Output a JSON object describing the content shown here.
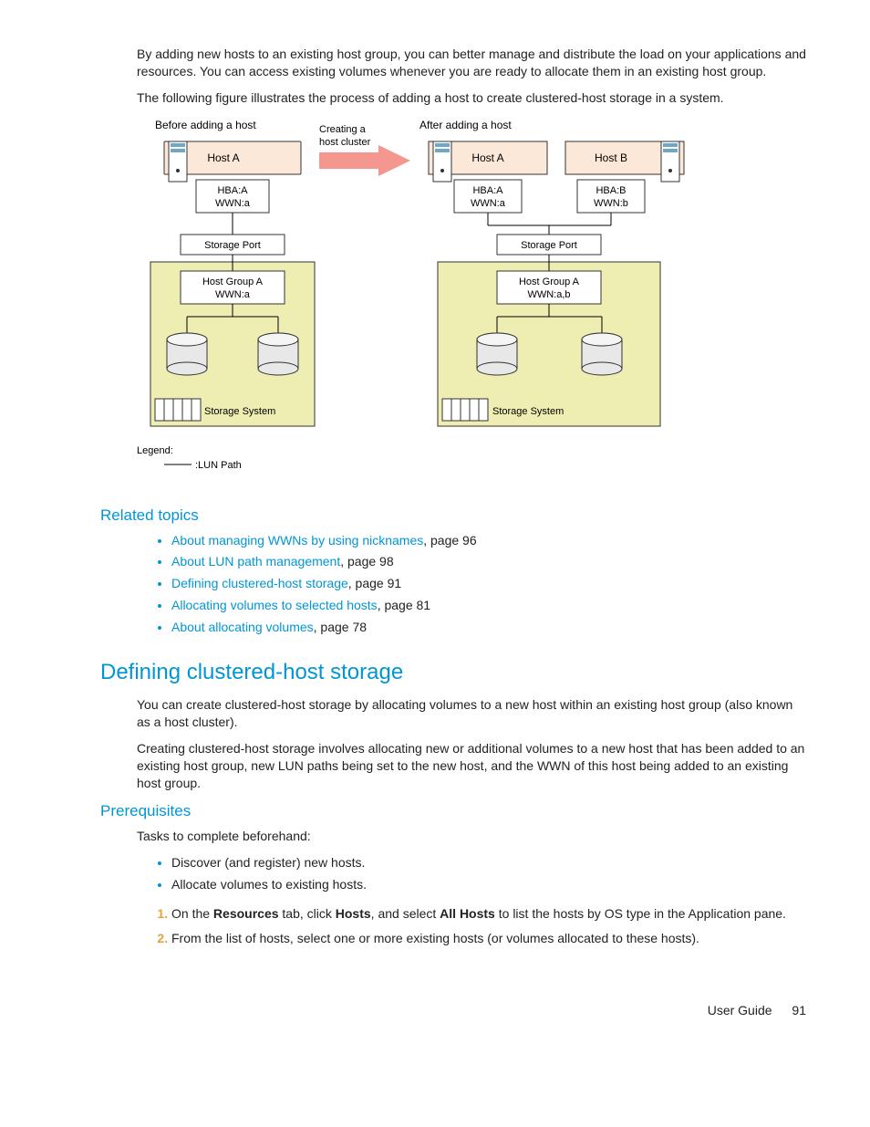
{
  "intro": {
    "p1": "By adding new hosts to an existing host group, you can better manage and distribute the load on your applications and resources. You can access existing volumes whenever you are ready to allocate them in an existing host group.",
    "p2": "The following figure illustrates the process of adding a host to create clustered-host storage in a system."
  },
  "figure": {
    "before_title": "Before adding a host",
    "creating": "Creating a",
    "creating2": "host cluster",
    "after_title": "After adding a host",
    "hostA": "Host A",
    "hostB": "Host B",
    "hbaA": "HBA:A",
    "wwna": "WWN:a",
    "hbaB": "HBA:B",
    "wwnb": "WWN:b",
    "storage_port": "Storage Port",
    "hostgroupA": "Host Group A",
    "wwn_a": "WWN:a",
    "wwn_ab": "WWN:a,b",
    "storage_system": "Storage System",
    "legend": "Legend:",
    "legend_lun": ":LUN Path"
  },
  "related": {
    "heading": "Related topics",
    "items": [
      {
        "link": "About managing WWNs by using nicknames",
        "suffix": ", page 96"
      },
      {
        "link": "About LUN path management",
        "suffix": ", page 98"
      },
      {
        "link": "Defining clustered-host storage",
        "suffix": ", page 91"
      },
      {
        "link": "Allocating volumes to selected hosts",
        "suffix": ", page 81"
      },
      {
        "link": "About allocating volumes",
        "suffix": ", page 78"
      }
    ]
  },
  "defining": {
    "heading": "Defining clustered-host storage",
    "p1": "You can create clustered-host storage by allocating volumes to a new host within an existing host group (also known as a host cluster).",
    "p2": "Creating clustered-host storage involves allocating new or additional volumes to a new host that has been added to an existing host group, new LUN paths being set to the new host, and the WWN of this host being added to an existing host group."
  },
  "prereq": {
    "heading": "Prerequisites",
    "lead": "Tasks to complete beforehand:",
    "bullets": [
      "Discover (and register) new hosts.",
      "Allocate volumes to existing hosts."
    ],
    "steps": {
      "s1_a": "On the ",
      "s1_b": "Resources",
      "s1_c": " tab, click ",
      "s1_d": "Hosts",
      "s1_e": ", and select ",
      "s1_f": "All Hosts",
      "s1_g": " to list the hosts by OS type in the Application pane.",
      "s2": "From the list of hosts, select one or more existing hosts (or volumes allocated to these hosts)."
    }
  },
  "footer": {
    "label": "User Guide",
    "page": "91"
  }
}
